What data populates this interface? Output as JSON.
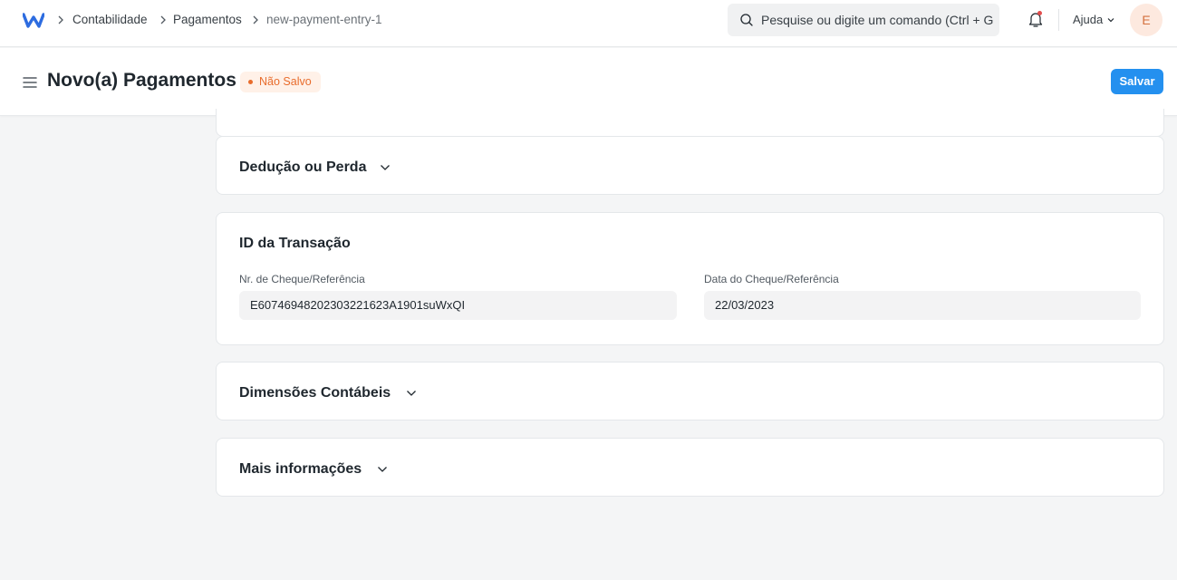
{
  "navbar": {
    "breadcrumbs": [
      "Contabilidade",
      "Pagamentos",
      "new-payment-entry-1"
    ],
    "search_placeholder": "Pesquise ou digite um comando (Ctrl + G)",
    "help_label": "Ajuda",
    "avatar_initial": "E"
  },
  "header": {
    "title": "Novo(a) Pagamentos",
    "status": "Não Salvo",
    "save_label": "Salvar"
  },
  "sections": {
    "deduction": {
      "title": "Dedução ou Perda"
    },
    "transaction": {
      "title": "ID da Transação",
      "reference_no": {
        "label": "Nr. de Cheque/Referência",
        "value": "E60746948202303221623A1901suWxQI"
      },
      "reference_date": {
        "label": "Data do Cheque/Referência",
        "value": "22/03/2023"
      }
    },
    "dimensions": {
      "title": "Dimensões Contábeis"
    },
    "more_info": {
      "title": "Mais informações"
    }
  },
  "colors": {
    "primary": "#2490ef",
    "status": "#e86c2c",
    "avatar_bg": "#fde9df"
  },
  "icons": [
    "app-logo",
    "chevron-right-icon",
    "search-icon",
    "bell-icon",
    "chevron-down-icon",
    "hamburger-icon"
  ]
}
